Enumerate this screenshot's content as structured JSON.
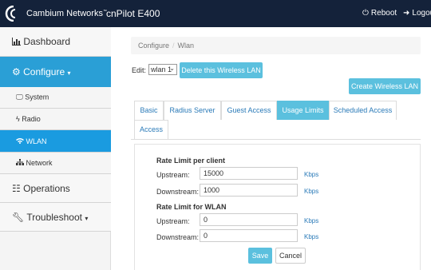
{
  "header": {
    "brand": "Cambium Networks",
    "brand_tm": "™",
    "product": "cnPilot E400",
    "reboot_label": "Reboot",
    "logout_label": "Logou"
  },
  "sidebar": {
    "dashboard": "Dashboard",
    "configure": "Configure",
    "configure_items": [
      "System",
      "Radio",
      "WLAN",
      "Network"
    ],
    "operations": "Operations",
    "troubleshoot": "Troubleshoot"
  },
  "breadcrumb": {
    "items": [
      "Configure",
      "Wlan"
    ],
    "separator": "/"
  },
  "edit": {
    "label": "Edit:",
    "selected": "wlan 1",
    "delete_label": "Delete this Wireless LAN",
    "create_label": "Create Wireless LAN"
  },
  "tabs": {
    "items": [
      "Basic",
      "Radius Server",
      "Guest Access",
      "Usage Limits",
      "Scheduled Access",
      "Access"
    ],
    "active": "Usage Limits"
  },
  "per_client": {
    "title": "Rate Limit per client",
    "upstream_label": "Upstream:",
    "upstream_value": "15000",
    "downstream_label": "Downstream:",
    "downstream_value": "1000",
    "unit": "Kbps"
  },
  "wlan_limit": {
    "title": "Rate Limit for WLAN",
    "upstream_label": "Upstream:",
    "upstream_value": "0",
    "downstream_label": "Downstream:",
    "downstream_value": "0",
    "unit": "Kbps"
  },
  "actions": {
    "save": "Save",
    "cancel": "Cancel"
  },
  "colors": {
    "navbar": "#14223a",
    "accent": "#5bc0de",
    "active_sidebar": "#2a9fd6",
    "link": "#2a7ab8"
  }
}
